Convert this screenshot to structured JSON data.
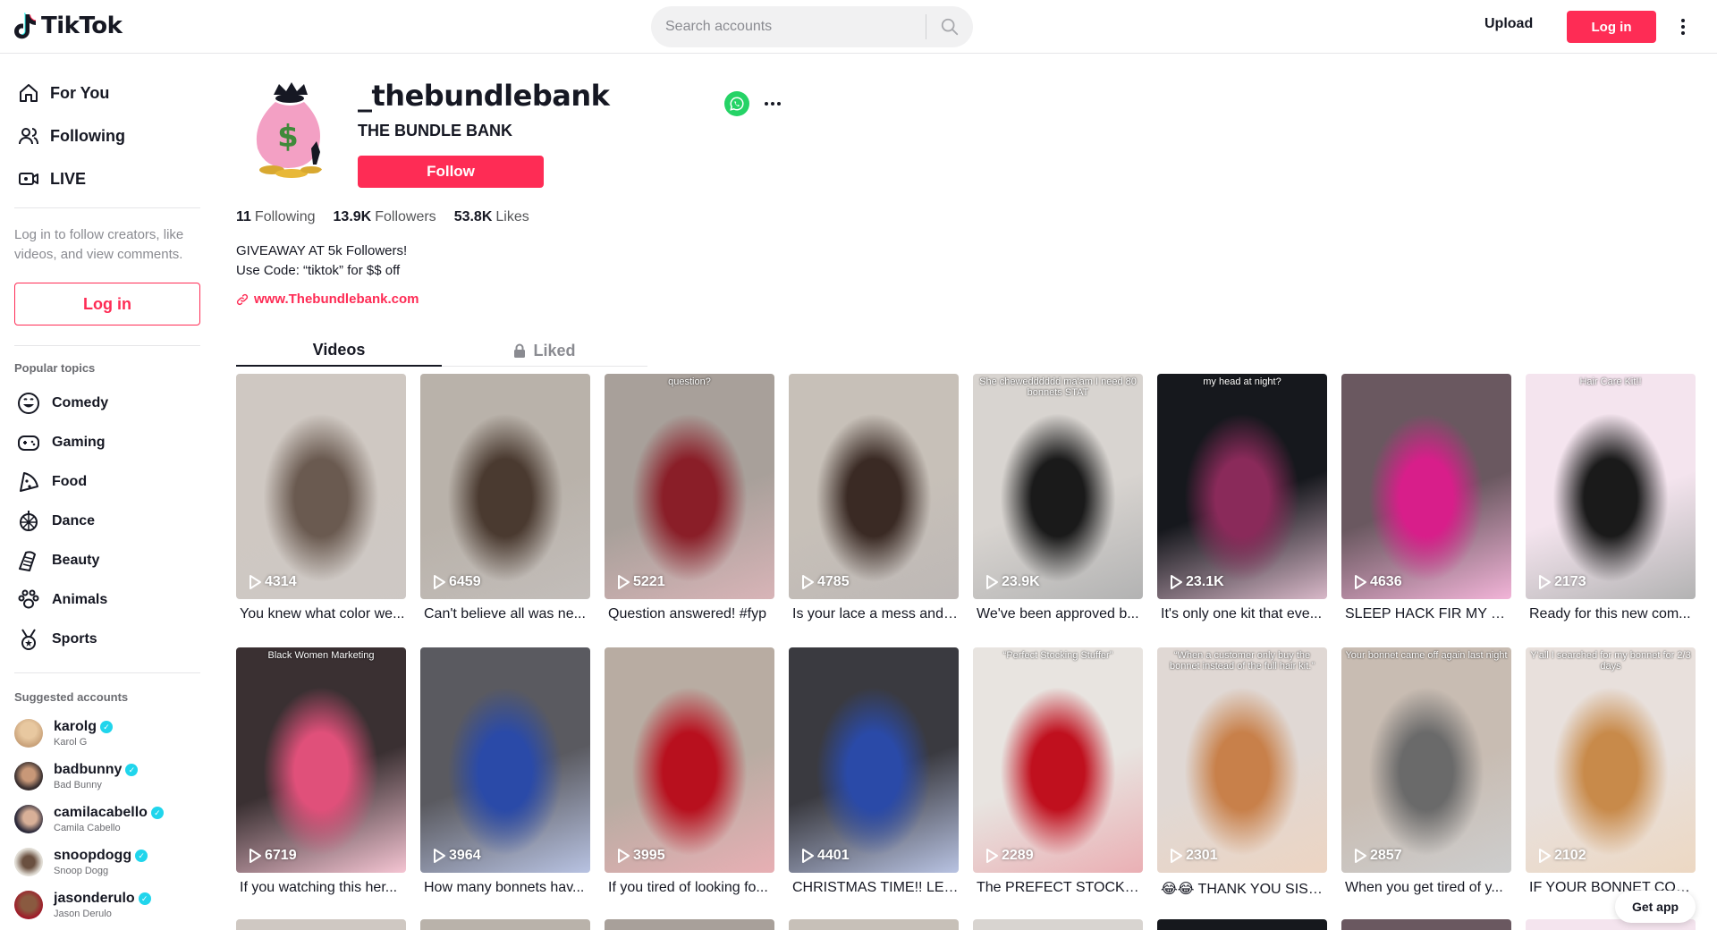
{
  "header": {
    "logo_text": "TikTok",
    "search_placeholder": "Search accounts",
    "upload_label": "Upload",
    "login_label": "Log in"
  },
  "sidebar": {
    "nav": [
      {
        "label": "For You",
        "icon": "home-icon"
      },
      {
        "label": "Following",
        "icon": "users-icon"
      },
      {
        "label": "LIVE",
        "icon": "live-icon"
      }
    ],
    "login_prompt": "Log in to follow creators, like videos, and view comments.",
    "login_button": "Log in",
    "popular_topics_title": "Popular topics",
    "topics": [
      {
        "label": "Comedy",
        "icon": "comedy-icon"
      },
      {
        "label": "Gaming",
        "icon": "gaming-icon"
      },
      {
        "label": "Food",
        "icon": "food-icon"
      },
      {
        "label": "Dance",
        "icon": "dance-icon"
      },
      {
        "label": "Beauty",
        "icon": "beauty-icon"
      },
      {
        "label": "Animals",
        "icon": "animals-icon"
      },
      {
        "label": "Sports",
        "icon": "sports-icon"
      }
    ],
    "suggested_title": "Suggested accounts",
    "accounts": [
      {
        "handle": "karolg",
        "name": "Karol G",
        "avatar_color": "#c9a27a"
      },
      {
        "handle": "badbunny",
        "name": "Bad Bunny",
        "avatar_color": "#3a3030"
      },
      {
        "handle": "camilacabello",
        "name": "Camila Cabello",
        "avatar_color": "#2c2a3a"
      },
      {
        "handle": "snoopdogg",
        "name": "Snoop Dogg",
        "avatar_color": "#8a8378"
      },
      {
        "handle": "jasonderulo",
        "name": "Jason Derulo",
        "avatar_color": "#5a3a30"
      }
    ]
  },
  "profile": {
    "username": "_thebundlebank",
    "nickname": "THE BUNDLE BANK",
    "follow_label": "Follow",
    "stats": [
      {
        "num": "11",
        "label": "Following"
      },
      {
        "num": "13.9K",
        "label": "Followers"
      },
      {
        "num": "53.8K",
        "label": "Likes"
      }
    ],
    "bio_line1": "GIVEAWAY AT 5k Followers!",
    "bio_line2": "Use Code: “tiktok” for $$ off",
    "link": "www.Thebundlebank.com"
  },
  "tabs": {
    "videos": "Videos",
    "liked": "Liked"
  },
  "videos": [
    {
      "views": "4314",
      "caption": "You knew what color we...",
      "overlay": "",
      "colors": [
        "#cfc8c2",
        "#6a5a50"
      ]
    },
    {
      "views": "6459",
      "caption": "Can't believe all was ne...",
      "overlay": "",
      "colors": [
        "#b9b2aa",
        "#4a3a30"
      ]
    },
    {
      "views": "5221",
      "caption": "Question answered! #fyp",
      "overlay": "question?",
      "colors": [
        "#a8a09a",
        "#8a1e28"
      ]
    },
    {
      "views": "4785",
      "caption": "Is your lace a mess and ...",
      "overlay": "",
      "colors": [
        "#c7c0b8",
        "#3a2a24"
      ]
    },
    {
      "views": "23.9K",
      "caption": "We've been approved b...",
      "overlay": "She chewedddddd ma'am I need 80 bonnets STAT",
      "colors": [
        "#d8d4d0",
        "#1a1a1a"
      ]
    },
    {
      "views": "23.1K",
      "caption": "It's only one kit that eve...",
      "overlay": "my head at night?",
      "colors": [
        "#16181d",
        "#8a2a5a"
      ]
    },
    {
      "views": "4636",
      "caption": "SLEEP HACK FIR MY FI...",
      "overlay": "",
      "colors": [
        "#6a5860",
        "#d81e8a"
      ]
    },
    {
      "views": "2173",
      "caption": "Ready for this new com...",
      "overlay": "Hair Care Kit!!",
      "colors": [
        "#f4e4ee",
        "#1a1a1a"
      ]
    },
    {
      "views": "6719",
      "caption": "If you watching this her...",
      "overlay": "Black Women Marketing",
      "colors": [
        "#3a3032",
        "#e0507a"
      ]
    },
    {
      "views": "3964",
      "caption": "How many bonnets hav...",
      "overlay": "",
      "colors": [
        "#5a5a60",
        "#2a4aa8"
      ]
    },
    {
      "views": "3995",
      "caption": "If you tired of looking fo...",
      "overlay": "",
      "colors": [
        "#b8aca2",
        "#b8101e"
      ]
    },
    {
      "views": "4401",
      "caption": "CHRISTMAS TIME!! LET...",
      "overlay": "",
      "colors": [
        "#3a3a40",
        "#2a4aa8"
      ]
    },
    {
      "views": "2289",
      "caption": "The PREFECT STOCKIN...",
      "overlay": "“Perfect Stocking Stuffer”",
      "colors": [
        "#e8e4e0",
        "#c0101e"
      ]
    },
    {
      "views": "2301",
      "caption": "😂😂 THANK YOU SIST...",
      "overlay": "“When a customer only buy the bonnet instead of the full hair kit.”",
      "colors": [
        "#e0d8d4",
        "#c8804a"
      ]
    },
    {
      "views": "2857",
      "caption": "When you get tired of y...",
      "overlay": "Your bonnet came off again last night",
      "colors": [
        "#c8bcb2",
        "#6a6a6a"
      ]
    },
    {
      "views": "2102",
      "caption": "IF YOUR BONNET COM...",
      "overlay": "Y'all I searched for my bonnet for 2/3 days",
      "colors": [
        "#e8e0dc",
        "#c88a4a"
      ]
    }
  ],
  "get_app": "Get app",
  "colors": {
    "accent": "#fe2c55",
    "verified": "#20d5ec"
  }
}
